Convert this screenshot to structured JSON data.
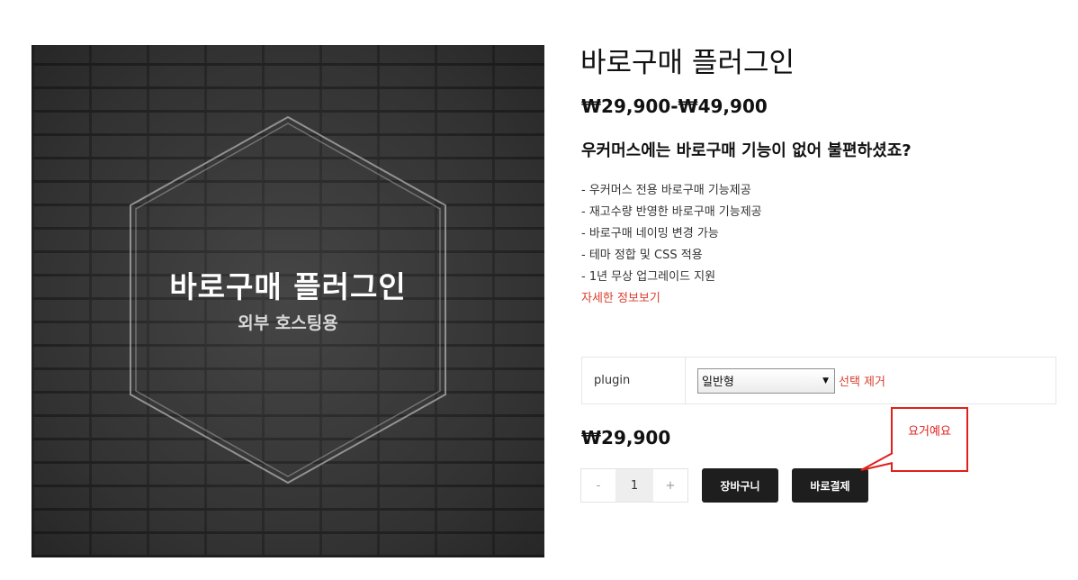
{
  "product_image": {
    "title": "바로구매 플러그인",
    "subtitle": "외부 호스팅용"
  },
  "summary": {
    "title": "바로구매 플러그인",
    "price_range": "₩29,900-₩49,900",
    "headline": "우커머스에는 바로구매 기능이 없어 불편하셨죠?",
    "features": [
      "- 우커머스 전용 바로구매 기능제공",
      "- 재고수량 반영한 바로구매 기능제공",
      "- 바로구매 네이밍 변경 가능",
      "- 테마 정합 및 CSS 적용",
      "- 1년 무상 업그레이드 지원"
    ],
    "more_link": "자세한 정보보기"
  },
  "variations": {
    "label": "plugin",
    "selected": "일반형",
    "reset_link": "선택 제거"
  },
  "price": "₩29,900",
  "quantity": {
    "minus": "-",
    "value": "1",
    "plus": "+"
  },
  "buttons": {
    "add_to_cart": "장바구니",
    "buy_now": "바로결제"
  },
  "annotation": {
    "text": "요거예요",
    "color": "#e0201b"
  },
  "colors": {
    "link_red": "#d9402f",
    "button_dark": "#1e1e1e"
  },
  "icons": {
    "select_arrow": "dropdown-arrow-icon"
  }
}
